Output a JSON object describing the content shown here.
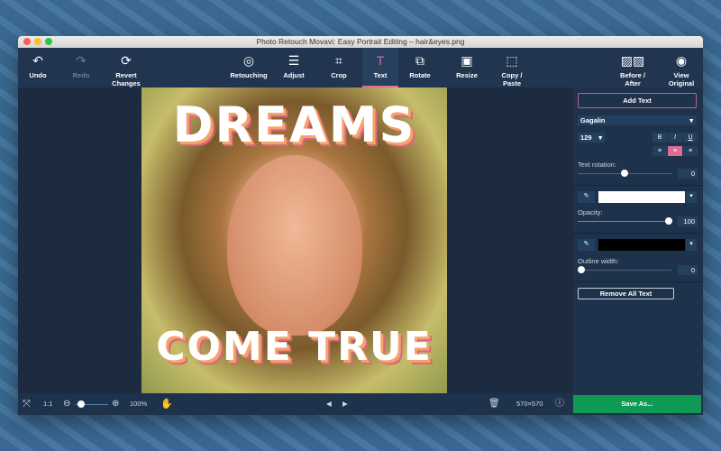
{
  "window": {
    "title": "Photo Retouch Movavi: Easy Portrait Editing – hair&eyes.png"
  },
  "toolbar": {
    "undo": "Undo",
    "redo": "Redo",
    "revert": "Revert Changes",
    "tools": [
      {
        "label": "Retouching",
        "icon": "retouch-face-icon"
      },
      {
        "label": "Adjust",
        "icon": "sliders-icon"
      },
      {
        "label": "Crop",
        "icon": "crop-icon"
      },
      {
        "label": "Text",
        "icon": "text-icon",
        "active": true
      },
      {
        "label": "Rotate",
        "icon": "rotate-icon"
      },
      {
        "label": "Resize",
        "icon": "resize-icon"
      },
      {
        "label": "Copy / Paste",
        "icon": "copy-paste-icon"
      }
    ],
    "before_after": "Before / After",
    "view_original": "View Original"
  },
  "photo": {
    "top_text": "DREAMS",
    "bottom_text": "COME TRUE"
  },
  "panel": {
    "add_text": "Add Text",
    "font": "Gagalin",
    "size": "129",
    "bold": "B",
    "italic": "I",
    "underline": "U",
    "rotation_label": "Text rotation:",
    "rotation_value": "0",
    "text_color": "#ffffff",
    "opacity_label": "Opacity:",
    "opacity_value": "100",
    "outline_color": "#000000",
    "outline_label": "Outline width:",
    "outline_value": "0",
    "remove_all": "Remove All Text"
  },
  "bottom": {
    "ratio": "1:1",
    "zoom": "100%",
    "dimensions": "570×570",
    "save": "Save As..."
  },
  "colors": {
    "accent": "#e06a98",
    "save": "#0f9a55"
  }
}
